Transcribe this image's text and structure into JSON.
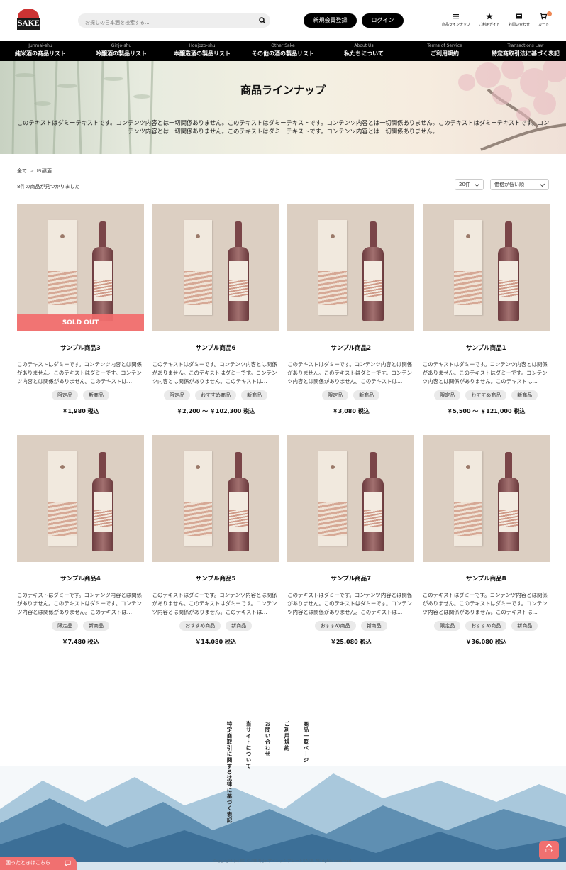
{
  "header": {
    "logo_text": "SAKE",
    "search_placeholder": "お探しの日本酒を検索する...",
    "register_label": "新規会員登録",
    "login_label": "ログイン",
    "icons": [
      {
        "icon": "menu-icon",
        "label": "商品ラインナップ"
      },
      {
        "icon": "star-icon",
        "label": "ご利用ガイド"
      },
      {
        "icon": "mail-icon",
        "label": "お問い合わせ"
      },
      {
        "icon": "cart-icon",
        "label": "カート"
      }
    ]
  },
  "nav": [
    {
      "en": "Junmai-shu",
      "jp": "純米酒の商品リスト"
    },
    {
      "en": "Ginjo-shu",
      "jp": "吟醸酒の製品リスト"
    },
    {
      "en": "Honjozo-shu",
      "jp": "本醸造酒の製品リスト"
    },
    {
      "en": "Other Sake",
      "jp": "その他の酒の製品リスト"
    },
    {
      "en": "About Us",
      "jp": "私たちについて"
    },
    {
      "en": "Terms of Service",
      "jp": "ご利用規約"
    },
    {
      "en": "Transactions Law",
      "jp": "特定商取引法に基づく表記"
    }
  ],
  "hero": {
    "title": "商品ラインナップ",
    "text": "このテキストはダミーテキストです。コンテンツ内容とは一切関係ありません。このテキストはダミーテキストです。コンテンツ内容とは一切関係ありません。このテキストはダミーテキストです。コンテンツ内容とは一切関係ありません。このテキストはダミーテキストです。コンテンツ内容とは一切関係ありません。"
  },
  "breadcrumb": {
    "root": "全て",
    "separator": ">",
    "current": "吟醸酒"
  },
  "results_text": "8件の商品が見つかりました",
  "per_page": "20件",
  "sort": "価格が低い順",
  "products": [
    {
      "name": "サンプル商品3",
      "desc": "このテキストはダミーです。コンテンツ内容とは関係がありません。このテキストはダミーです。コンテンツ内容とは関係がありません。このテキストは…",
      "tags": [
        "限定品",
        "新商品"
      ],
      "price": "￥1,980 税込",
      "sold_out": "SOLD OUT"
    },
    {
      "name": "サンプル商品6",
      "desc": "このテキストはダミーです。コンテンツ内容とは関係がありません。このテキストはダミーです。コンテンツ内容とは関係がありません。このテキストは…",
      "tags": [
        "限定品",
        "おすすめ商品",
        "新商品"
      ],
      "price": "￥2,200 〜 ￥102,300 税込"
    },
    {
      "name": "サンプル商品2",
      "desc": "このテキストはダミーです。コンテンツ内容とは関係がありません。このテキストはダミーです。コンテンツ内容とは関係がありません。このテキストは…",
      "tags": [
        "限定品",
        "新商品"
      ],
      "price": "￥3,080 税込"
    },
    {
      "name": "サンプル商品1",
      "desc": "このテキストはダミーです。コンテンツ内容とは関係がありません。このテキストはダミーです。コンテンツ内容とは関係がありません。このテキストは…",
      "tags": [
        "限定品",
        "おすすめ商品",
        "新商品"
      ],
      "price": "￥5,500 〜 ￥121,000 税込"
    },
    {
      "name": "サンプル商品4",
      "desc": "このテキストはダミーです。コンテンツ内容とは関係がありません。このテキストはダミーです。コンテンツ内容とは関係がありません。このテキストは…",
      "tags": [
        "限定品",
        "新商品"
      ],
      "price": "￥7,480 税込"
    },
    {
      "name": "サンプル商品5",
      "desc": "このテキストはダミーです。コンテンツ内容とは関係がありません。このテキストはダミーです。コンテンツ内容とは関係がありません。このテキストは…",
      "tags": [
        "おすすめ商品",
        "新商品"
      ],
      "price": "￥14,080 税込"
    },
    {
      "name": "サンプル商品7",
      "desc": "このテキストはダミーです。コンテンツ内容とは関係がありません。このテキストはダミーです。コンテンツ内容とは関係がありません。このテキストは…",
      "tags": [
        "おすすめ商品",
        "新商品"
      ],
      "price": "￥25,080 税込"
    },
    {
      "name": "サンプル商品8",
      "desc": "このテキストはダミーです。コンテンツ内容とは関係がありません。このテキストはダミーです。コンテンツ内容とは関係がありません。このテキストは…",
      "tags": [
        "限定品",
        "おすすめ商品",
        "新商品"
      ],
      "price": "￥36,080 税込"
    }
  ],
  "footer": {
    "links": [
      "特定商取引に関する法律に基づく表記",
      "当サイトについて",
      "お問い合わせ",
      "ご利用規約",
      "商品一覧ページ"
    ],
    "copyright": "Copyright (c) EC-CUBE4用デザインテンプレートSAKE. All rights reserved.",
    "help_label": "困ったときはこちら",
    "top_label": "TOP"
  },
  "colors": {
    "accent": "#f07070",
    "nav_bg": "#000000",
    "tag_bg": "#eaeaea"
  }
}
